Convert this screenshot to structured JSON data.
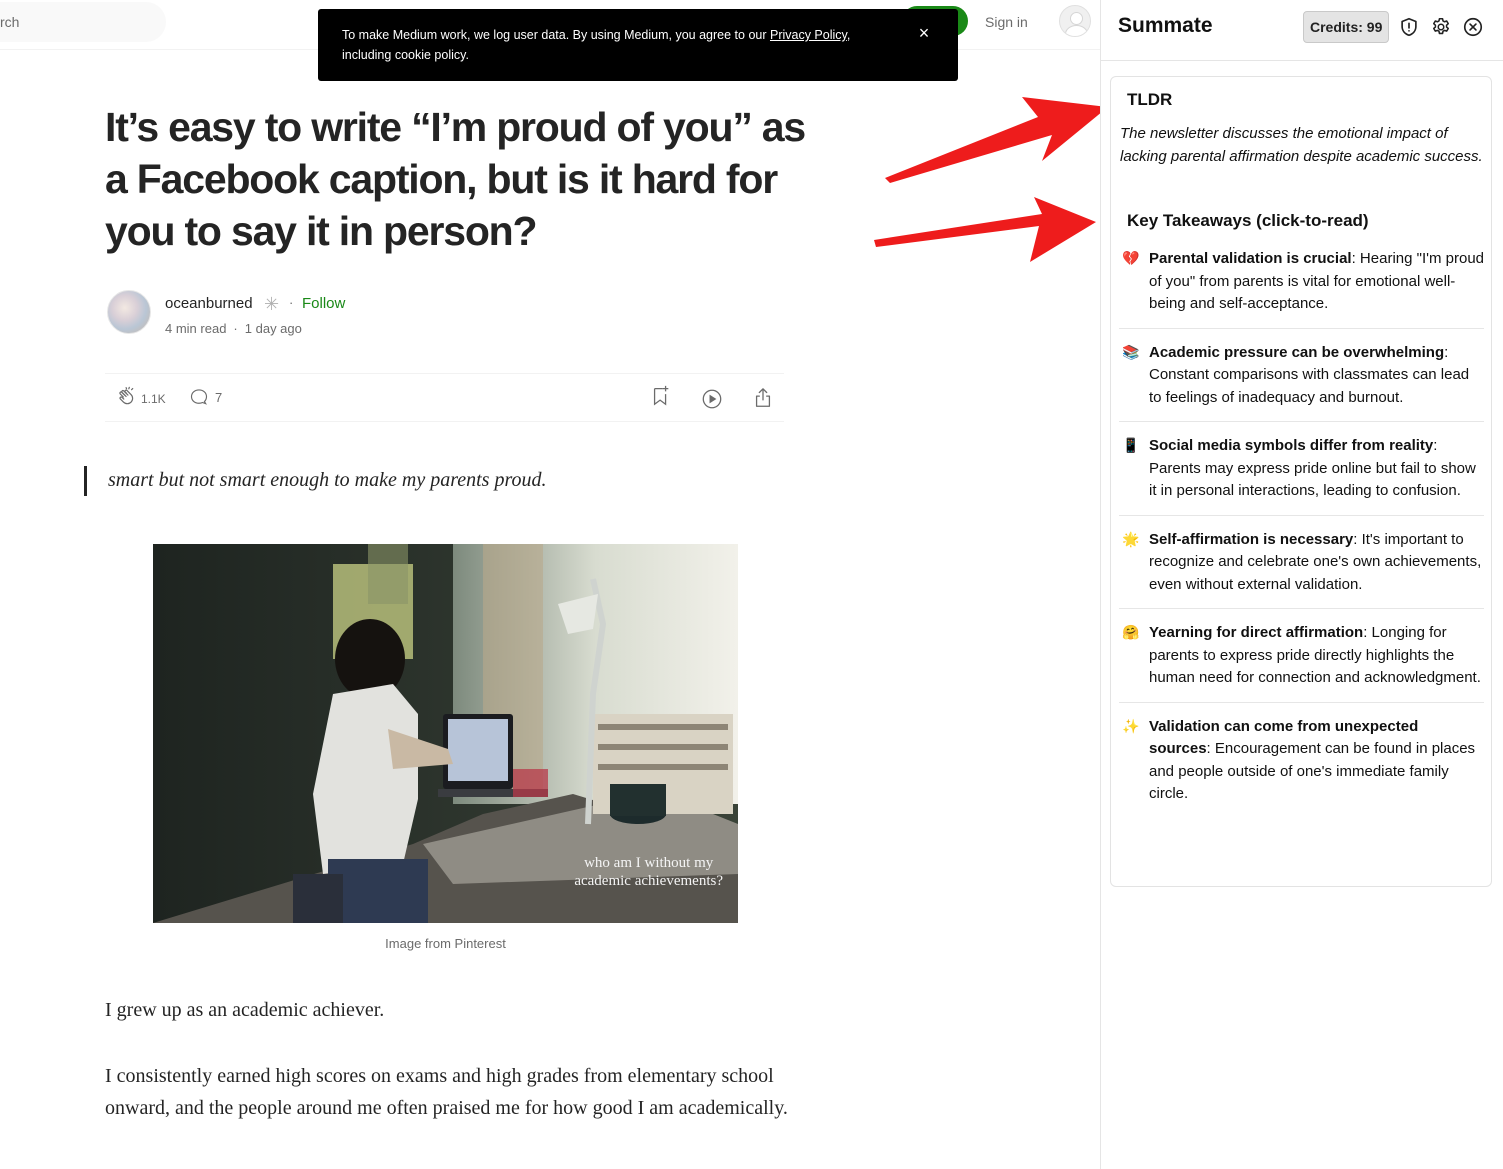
{
  "medium": {
    "search_placeholder": "rch",
    "sign_in": "Sign in",
    "cookie": {
      "text_before": "To make Medium work, we log user data. By using Medium, you agree to our ",
      "link": "Privacy Policy",
      "text_after": ", including cookie policy.",
      "close": "×"
    },
    "headline": "It’s easy to write “I’m proud of you” as a Facebook caption, but is it hard for you to say it in person?",
    "author": {
      "name": "oceanburned",
      "separator": "·",
      "follow": "Follow",
      "read_time": "4 min read",
      "meta_separator": "·",
      "posted": "1 day ago"
    },
    "actions": {
      "claps": "1.1K",
      "responses": "7"
    },
    "pullquote": "smart but not smart enough to make my parents proud.",
    "image": {
      "overlay_line1": "who am I without my",
      "overlay_line2": "academic achievements?",
      "caption": "Image from Pinterest"
    },
    "paragraphs": [
      "I grew up as an academic achiever.",
      "I consistently earned high scores on exams and high grades from elementary school onward, and the people around me often praised me for how good I am academically."
    ]
  },
  "summate": {
    "title": "Summate",
    "credits": "Credits: 99",
    "tldr_heading": "TLDR",
    "tldr_text": "The newsletter discusses the emotional impact of lacking parental affirmation despite academic success.",
    "takeaways_heading": "Key Takeaways (click-to-read)",
    "takeaways": [
      {
        "emoji": "💔",
        "title": "Parental validation is crucial",
        "text": ": Hearing \"I'm proud of you\" from parents is vital for emotional well-being and self-acceptance."
      },
      {
        "emoji": "📚",
        "title": "Academic pressure can be overwhelming",
        "text": ": Constant comparisons with classmates can lead to feelings of inadequacy and burnout."
      },
      {
        "emoji": "📱",
        "title": "Social media symbols differ from reality",
        "text": ": Parents may express pride online but fail to show it in personal interactions, leading to confusion."
      },
      {
        "emoji": "🌟",
        "title": "Self-affirmation is necessary",
        "text": ": It's important to recognize and celebrate one's own achievements, even without external validation."
      },
      {
        "emoji": "🤗",
        "title": "Yearning for direct affirmation",
        "text": ": Longing for parents to express pride directly highlights the human need for connection and acknowledgment."
      },
      {
        "emoji": "✨",
        "title": "Validation can come from unexpected sources",
        "text": ": Encouragement can be found in places and people outside of one's immediate family circle."
      }
    ]
  },
  "colors": {
    "medium_green": "#1a8917",
    "annotation_arrow": "#ee1c1c",
    "cookie_bg": "#000000"
  }
}
